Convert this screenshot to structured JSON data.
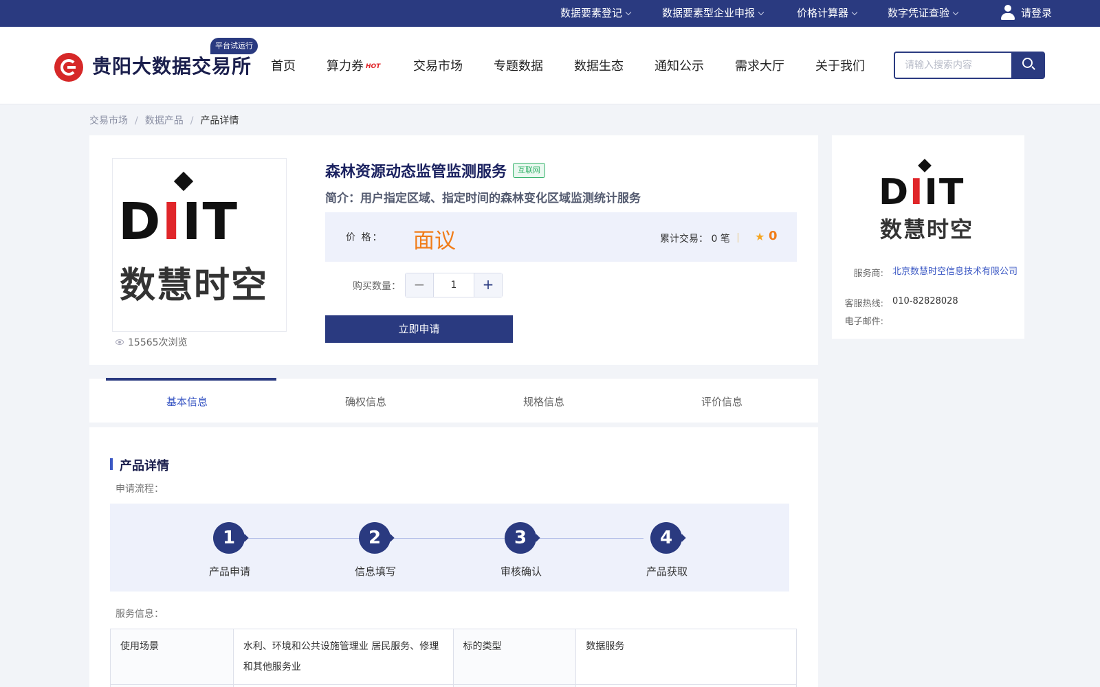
{
  "topbar": {
    "items": [
      {
        "label": "数据要素登记"
      },
      {
        "label": "数据要素型企业申报"
      },
      {
        "label": "价格计算器"
      },
      {
        "label": "数字凭证查验"
      }
    ],
    "login_label": "请登录"
  },
  "header": {
    "logo_text": "贵阳大数据交易所",
    "trial_badge": "平台试运行",
    "nav": [
      {
        "label": "首页"
      },
      {
        "label": "算力券"
      },
      {
        "label": "交易市场"
      },
      {
        "label": "专题数据"
      },
      {
        "label": "数据生态"
      },
      {
        "label": "通知公示"
      },
      {
        "label": "需求大厅"
      },
      {
        "label": "关于我们"
      }
    ],
    "hot_badge": "HOT",
    "search_placeholder": "请输入搜索内容"
  },
  "breadcrumb": {
    "items": [
      "交易市场",
      "数据产品"
    ],
    "current": "产品详情"
  },
  "product": {
    "logo_word": {
      "a": "D",
      "b": "I",
      "c": "IT"
    },
    "logo_cn": "数慧时空",
    "views": "15565次浏览",
    "title": "森林资源动态监管监测服务",
    "tag": "互联网",
    "intro": "简介：用户指定区域、指定时间的森林变化区域监测统计服务",
    "price_label": "价 格：",
    "price_value": "面议",
    "trade_count": "累计交易： 0 笔",
    "rating": "0",
    "qty_label": "购买数量：",
    "qty_value": "1",
    "apply_label": "立即申请"
  },
  "provider": {
    "service_key": "服务商:",
    "service_val": "北京数慧时空信息技术有限公司",
    "hotline_key": "客服热线:",
    "hotline_val": "010-82828028",
    "email_key": "电子邮件:",
    "email_val": ""
  },
  "tabs": [
    {
      "label": "基本信息"
    },
    {
      "label": "确权信息"
    },
    {
      "label": "规格信息"
    },
    {
      "label": "评价信息"
    }
  ],
  "detail": {
    "section_title": "产品详情",
    "process_label": "申请流程：",
    "steps": [
      {
        "num": "1",
        "label": "产品申请"
      },
      {
        "num": "2",
        "label": "信息填写"
      },
      {
        "num": "3",
        "label": "审核确认"
      },
      {
        "num": "4",
        "label": "产品获取"
      }
    ],
    "service_label": "服务信息：",
    "table": {
      "row1": {
        "k1": "使用场景",
        "v1": "水利、环境和公共设施管理业 居民服务、修理和其他服务业",
        "k2": "标的类型",
        "v2": "数据服务"
      }
    }
  }
}
